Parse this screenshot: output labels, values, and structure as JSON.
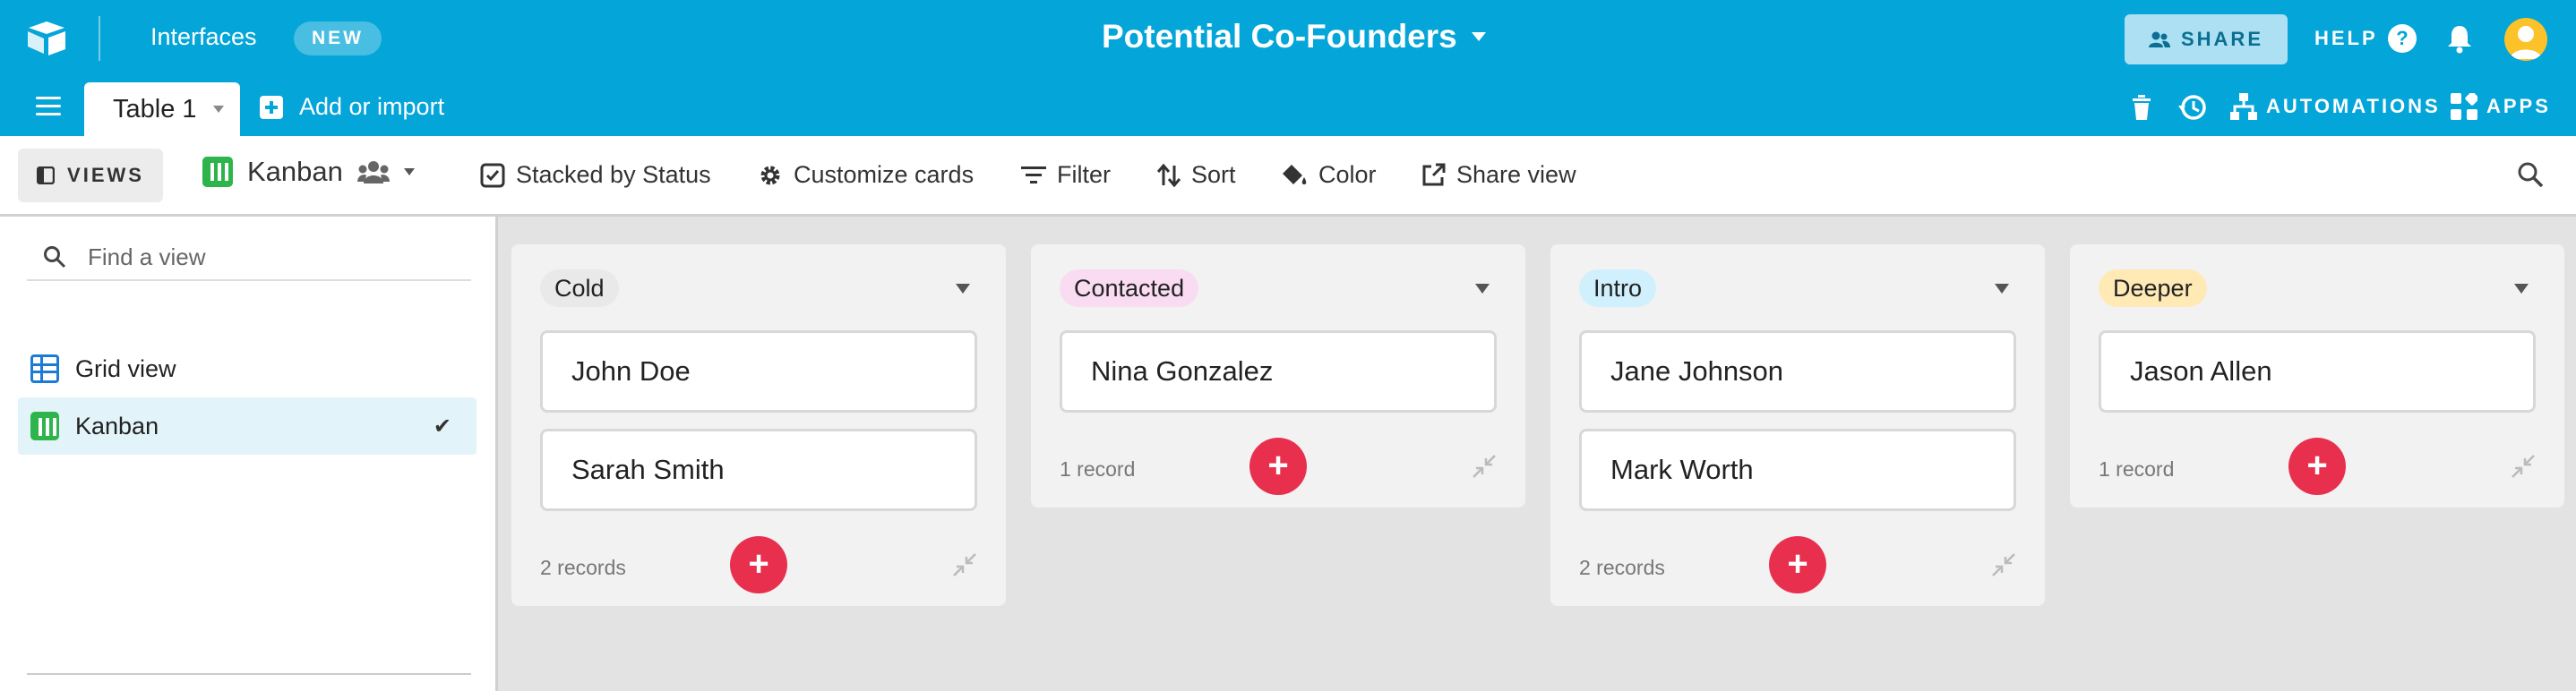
{
  "header": {
    "interfaces": "Interfaces",
    "new_badge": "NEW",
    "base_title": "Potential Co-Founders",
    "share": "SHARE",
    "help": "HELP"
  },
  "tabbar": {
    "table_tab": "Table 1",
    "add_import": "Add or import",
    "automations": "AUTOMATIONS",
    "apps": "APPS"
  },
  "viewbar": {
    "views": "VIEWS",
    "view_name": "Kanban",
    "stacked": "Stacked by Status",
    "customize": "Customize cards",
    "filter": "Filter",
    "sort": "Sort",
    "color": "Color",
    "share_view": "Share view"
  },
  "sidebar": {
    "search_placeholder": "Find a view",
    "items": [
      {
        "label": "Grid view",
        "icon": "grid-icon"
      },
      {
        "label": "Kanban",
        "icon": "kanban-icon",
        "active": true
      }
    ]
  },
  "columns": [
    {
      "name": "Cold",
      "pill_color": "#e9e9e9",
      "cards": [
        "John Doe",
        "Sarah Smith"
      ],
      "count": "2 records"
    },
    {
      "name": "Contacted",
      "pill_color": "#fadcf2",
      "cards": [
        "Nina Gonzalez"
      ],
      "count": "1 record"
    },
    {
      "name": "Intro",
      "pill_color": "#d0f0fd",
      "cards": [
        "Jane Johnson",
        "Mark Worth"
      ],
      "count": "2 records"
    },
    {
      "name": "Deeper",
      "pill_color": "#ffeab6",
      "cards": [
        "Jason Allen"
      ],
      "count": "1 record"
    }
  ],
  "colors": {
    "header_bg": "#04a5d8",
    "add_button": "#e8304e",
    "kanban_green": "#2db44b",
    "grid_blue": "#1d7bd5"
  }
}
